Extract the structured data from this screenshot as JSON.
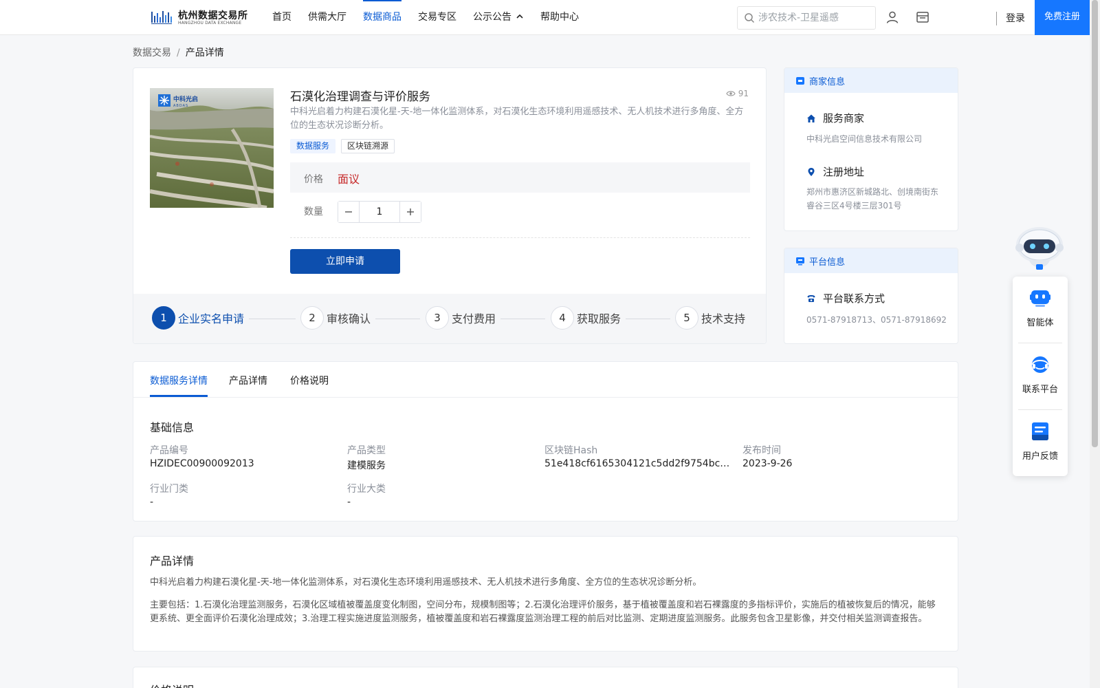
{
  "header": {
    "logo_cn": "杭州数据交易所",
    "logo_en": "HANGZHOU DATA EXCHANGE",
    "nav": [
      {
        "label": "首页",
        "active": false
      },
      {
        "label": "供需大厅",
        "active": false
      },
      {
        "label": "数据商品",
        "active": true
      },
      {
        "label": "交易专区",
        "active": false
      },
      {
        "label": "公示公告",
        "active": false,
        "caret": "^"
      },
      {
        "label": "帮助中心",
        "active": false
      }
    ],
    "search_placeholder": "涉农技术-卫星遥感",
    "login": "登录",
    "register": "免费注册"
  },
  "breadcrumb": {
    "parent": "数据交易",
    "separator": "/",
    "current": "产品详情"
  },
  "product": {
    "image_logo_cn": "中科光启",
    "image_logo_en": "ABDAS",
    "title": "石漠化治理调查与评价服务",
    "views": "91",
    "description": "中科光启着力构建石漠化星-天-地一体化监测体系，对石漠化生态环境利用遥感技术、无人机技术进行多角度、全方位的生态状况诊断分析。",
    "tags": [
      "数据服务",
      "区块链溯源"
    ],
    "price_label": "价格",
    "price_value": "面议",
    "quantity_label": "数量",
    "quantity_value": "1",
    "apply_button": "立即申请",
    "steps": [
      {
        "num": "1",
        "label": "企业实名申请",
        "active": true
      },
      {
        "num": "2",
        "label": "审核确认",
        "active": false
      },
      {
        "num": "3",
        "label": "支付费用",
        "active": false
      },
      {
        "num": "4",
        "label": "获取服务",
        "active": false
      },
      {
        "num": "5",
        "label": "技术支持",
        "active": false
      }
    ]
  },
  "merchant": {
    "heading": "商家信息",
    "service_label": "服务商家",
    "service_value": "中科光启空间信息技术有限公司",
    "address_label": "注册地址",
    "address_value": "郑州市惠济区新城路北、创境南街东睿谷三区4号楼三层301号"
  },
  "platform": {
    "heading": "平台信息",
    "contact_label": "平台联系方式",
    "contact_value": "0571-87918713、0571-87918692"
  },
  "floating": {
    "items": [
      {
        "label": "智能体",
        "icon": "agent-icon"
      },
      {
        "label": "联系平台",
        "icon": "headset-icon"
      },
      {
        "label": "用户反馈",
        "icon": "feedback-icon"
      }
    ]
  },
  "tabs": [
    "数据服务详情",
    "产品详情",
    "价格说明"
  ],
  "basic_info": {
    "title": "基础信息",
    "fields": [
      {
        "label": "产品编号",
        "value": "HZIDEC00900092013"
      },
      {
        "label": "产品类型",
        "value": "建模服务"
      },
      {
        "label": "区块链Hash",
        "value": "51e418cf6165304121c5dd2f9754bc83c17..."
      },
      {
        "label": "发布时间",
        "value": "2023-9-26"
      },
      {
        "label": "行业门类",
        "value": "-"
      },
      {
        "label": "行业大类",
        "value": "-"
      }
    ]
  },
  "product_detail": {
    "title": "产品详情",
    "paragraph1": "中科光启着力构建石漠化星-天-地一体化监测体系，对石漠化生态环境利用遥感技术、无人机技术进行多角度、全方位的生态状况诊断分析。",
    "paragraph2": "主要包括：1.石漠化治理监测服务，石漠化区域植被覆盖度变化制图，空间分布，规模制图等；2.石漠化治理评价服务，基于植被覆盖度和岩石裸露度的多指标评价，实施后的植被恢复后的情况，能够更系统、更全面评价石漠化治理成效；3.治理工程实施进度监测服务，植被覆盖度和岩石裸露度监测治理工程的前后对比监测、定期进度监测服务。此服务包含卫星影像，并交付相关监测调查报告。"
  },
  "price_section": {
    "title": "价格说明"
  },
  "colors": {
    "primary": "#0a5bd3",
    "button": "#0d4fae",
    "price": "#c62828",
    "register": "#1677ff"
  }
}
